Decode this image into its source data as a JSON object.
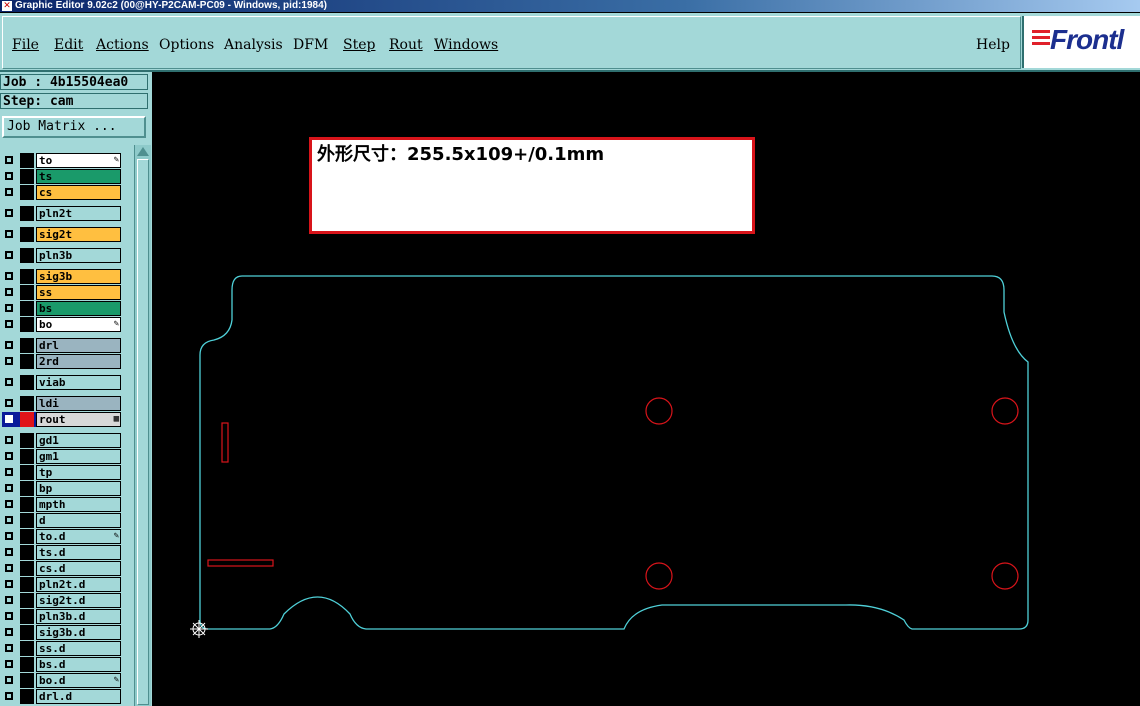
{
  "window": {
    "title": "Graphic Editor 9.02c2 (00@HY-P2CAM-PC09 - Windows, pid:1984)",
    "icon": "x-icon"
  },
  "menu": {
    "items": [
      "File",
      "Edit",
      "Actions",
      "Options",
      "Analysis",
      "DFM",
      "Step",
      "Rout",
      "Windows"
    ],
    "help": "Help"
  },
  "logo": {
    "text": "Frontl"
  },
  "job": {
    "line": "Job : 4b15504ea0",
    "step": "Step: cam",
    "matrix_button": "Job Matrix ..."
  },
  "layers": [
    {
      "name": "to",
      "color": "#ffffff",
      "mark": "pen-icon"
    },
    {
      "name": "ts",
      "color": "#1a9a6a"
    },
    {
      "name": "cs",
      "color": "#ffbf40"
    },
    {
      "name": "pln2t",
      "color": "#a3d8d8"
    },
    {
      "name": "sig2t",
      "color": "#ffbf40"
    },
    {
      "name": "pln3b",
      "color": "#a3d8d8"
    },
    {
      "name": "sig3b",
      "color": "#ffbf40"
    },
    {
      "name": "ss",
      "color": "#ffbf40"
    },
    {
      "name": "bs",
      "color": "#1a9a6a"
    },
    {
      "name": "bo",
      "color": "#ffffff",
      "mark": "pen-icon"
    },
    {
      "name": "drl",
      "color": "#9ab4c0"
    },
    {
      "name": "2rd",
      "color": "#9ab4c0"
    },
    {
      "name": "viab",
      "color": "#a3d8d8"
    },
    {
      "name": "ldi",
      "color": "#9ab4c0"
    },
    {
      "name": "rout",
      "color": "#d8d8d8",
      "mark": "grid-icon",
      "active": true
    },
    {
      "name": "gd1",
      "color": "#a3d8d8"
    },
    {
      "name": "gm1",
      "color": "#a3d8d8"
    },
    {
      "name": "tp",
      "color": "#a3d8d8"
    },
    {
      "name": "bp",
      "color": "#a3d8d8"
    },
    {
      "name": "mpth",
      "color": "#a3d8d8"
    },
    {
      "name": "d",
      "color": "#a3d8d8"
    },
    {
      "name": "to.d",
      "color": "#a3d8d8",
      "mark": "pen-icon"
    },
    {
      "name": "ts.d",
      "color": "#a3d8d8"
    },
    {
      "name": "cs.d",
      "color": "#a3d8d8"
    },
    {
      "name": "pln2t.d",
      "color": "#a3d8d8"
    },
    {
      "name": "sig2t.d",
      "color": "#a3d8d8"
    },
    {
      "name": "pln3b.d",
      "color": "#a3d8d8"
    },
    {
      "name": "sig3b.d",
      "color": "#a3d8d8"
    },
    {
      "name": "ss.d",
      "color": "#a3d8d8"
    },
    {
      "name": "bs.d",
      "color": "#a3d8d8"
    },
    {
      "name": "bo.d",
      "color": "#a3d8d8",
      "mark": "pen-icon"
    },
    {
      "name": "drl.d",
      "color": "#a3d8d8"
    }
  ],
  "canvas": {
    "note": "外形尺寸：255.5x109+/0.1mm",
    "outline_color": "#4fd0d8",
    "feature_color": "#d8141a"
  }
}
